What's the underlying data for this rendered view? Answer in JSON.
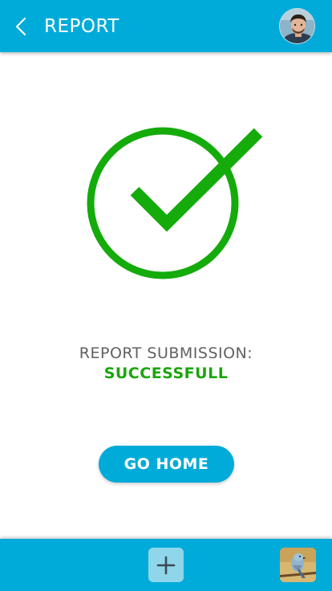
{
  "header": {
    "title": "REPORT",
    "back_icon": "chevron-left-icon",
    "avatar": "user-avatar"
  },
  "status": {
    "label": "REPORT SUBMISSION:",
    "value": "SUCCESSFULL",
    "icon": "check-circle-icon"
  },
  "actions": {
    "go_home_label": "GO HOME"
  },
  "bottom_bar": {
    "add_icon": "plus-icon",
    "thumbnail": "bird-photo-thumbnail"
  },
  "colors": {
    "primary": "#00abd9",
    "success": "#1aa50a",
    "text_gray": "#616161",
    "add_button_bg": "#8fd6ea"
  }
}
